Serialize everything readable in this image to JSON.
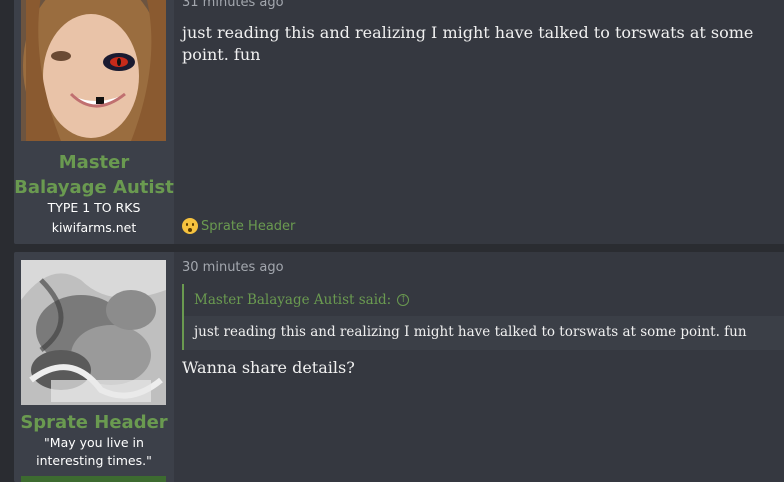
{
  "posts": [
    {
      "author": {
        "name_line1": "Master",
        "name_line2": "Balayage Autist",
        "title": "TYPE 1 TO RKS",
        "title2": "kiwifarms.net",
        "avatar": "woman-with-snake-eye-avatar"
      },
      "timestamp": "31 minutes ago",
      "message": "just reading this and realizing I might have talked to torswats at some point. fun",
      "reaction": {
        "icon": "surprised-emoji-icon",
        "user": "Sprate Header"
      }
    },
    {
      "author": {
        "name": "Sprate Header",
        "title_line1": "\"May you live in",
        "title_line2": "interesting times.\"",
        "avatar": "grey-smoke-avatar"
      },
      "timestamp": "30 minutes ago",
      "quote": {
        "author_label": "Master Balayage Autist said:",
        "icon": "arrow-up-circle-icon",
        "text": "just reading this and realizing I might have talked to torswats at some point. fun"
      },
      "message": "Wanna share details?"
    }
  ],
  "colors": {
    "accent_green": "#6a9a50",
    "post_bg": "#353840",
    "user_bg": "#3c4049"
  }
}
